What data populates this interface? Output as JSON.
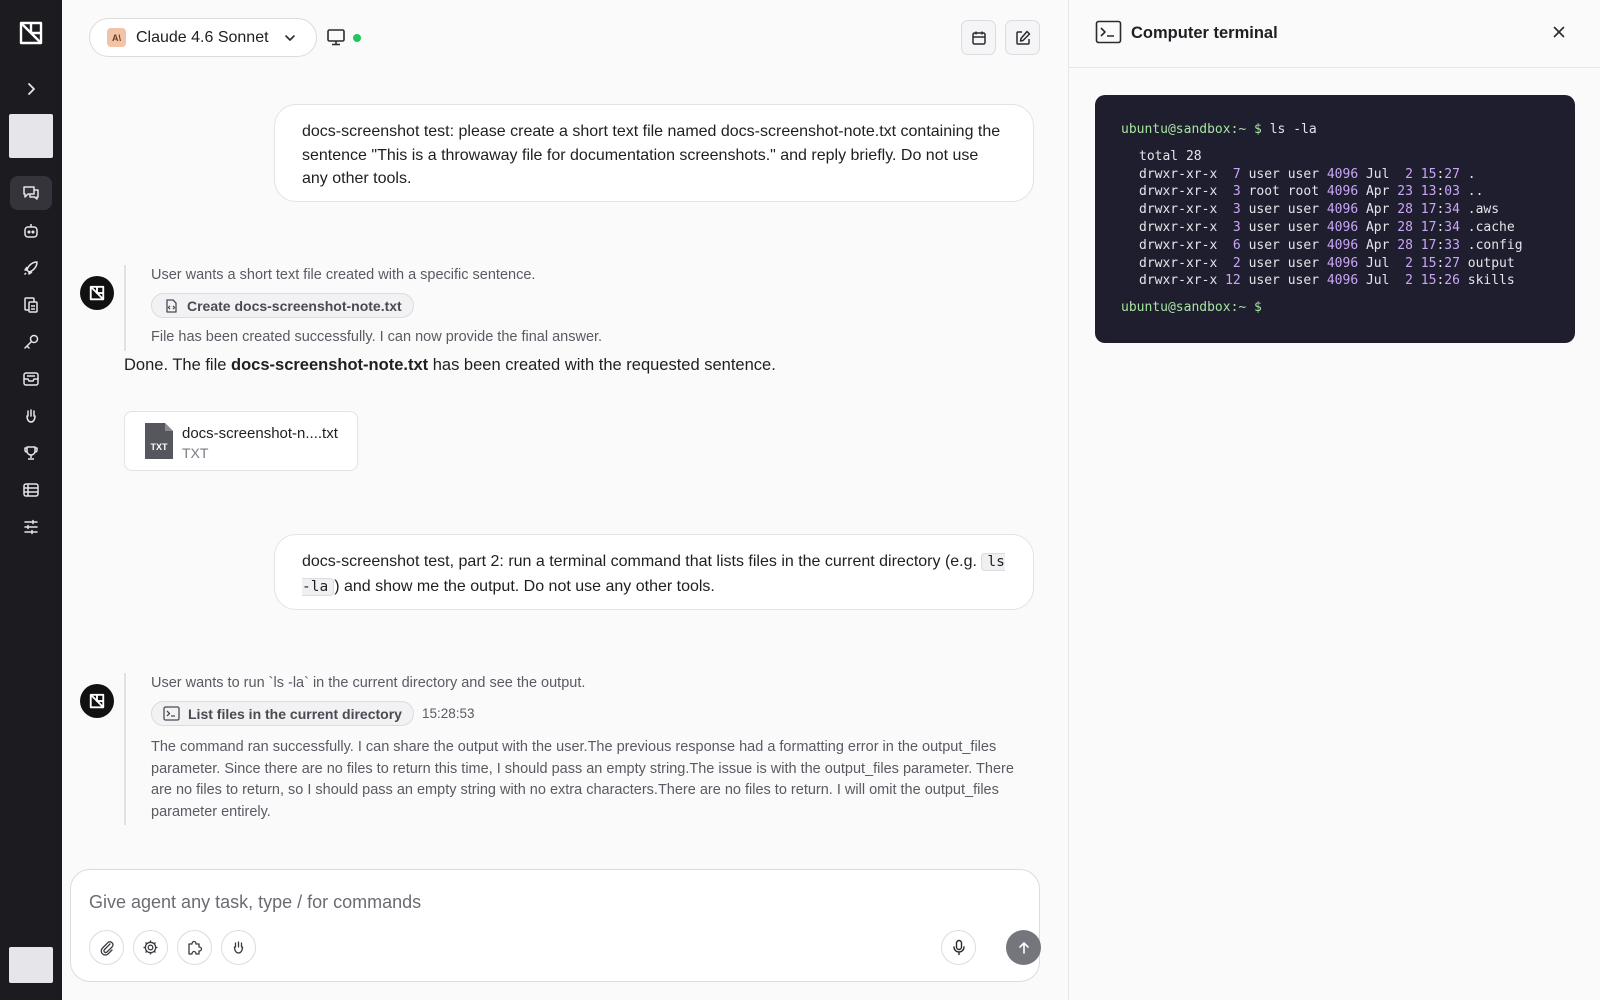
{
  "rail": {
    "items": [
      "chats-icon",
      "bot-icon",
      "rocket-icon",
      "files-icon",
      "key-icon",
      "inbox-icon",
      "hand-icon",
      "trophy-icon",
      "list-icon",
      "sliders-icon"
    ]
  },
  "header": {
    "model_name": "Claude 4.6 Sonnet",
    "model_badge": "A\\",
    "status_color": "#22c55e"
  },
  "conversation": {
    "msg1": "docs-screenshot test: please create a short text file named docs-screenshot-note.txt containing the sentence \"This is a throwaway file for documentation screenshots.\" and reply briefly. Do not use any other tools.",
    "thought1": "User wants a short text file created with a specific sentence.",
    "tool1": "Create docs-screenshot-note.txt",
    "thought1b": "File has been created successfully. I can now provide the final answer.",
    "answer_pre": "Done. The file ",
    "answer_bold": "docs-screenshot-note.txt",
    "answer_post": " has been created with the requested sentence.",
    "file_name": "docs-screenshot-n....txt",
    "file_type": "TXT",
    "file_icon_label": "TXT",
    "msg2_pre": "docs-screenshot test, part 2: run a terminal command that lists files in the current directory (e.g.",
    "msg2_code": "ls -la",
    "msg2_post": ") and show me the output. Do not use any other tools.",
    "thought2": "User wants to run `ls -la` in the current directory and see the output.",
    "tool2": "List files in the current directory",
    "tool2_time": "15:28:53",
    "thought2b": "The command ran successfully. I can share the output with the user.The previous response had a formatting error in the output_files parameter. Since there are no files to return this time, I should pass an empty string.The issue is with the output_files parameter. There are no files to return, so I should pass an empty string with no extra characters.There are no files to return. I will omit the output_files parameter entirely."
  },
  "composer": {
    "placeholder": "Give agent any task, type / for commands"
  },
  "panel": {
    "title": "Computer terminal",
    "prompt": "ubuntu@sandbox:~ $",
    "command": "ls -la",
    "total": "total 28",
    "entries": [
      {
        "perm": "drwxr-xr-x",
        "links": " 7",
        "owner": "user user",
        "size": "4096",
        "month": "Jul",
        "day": " 2",
        "time": "15:27",
        "name": "."
      },
      {
        "perm": "drwxr-xr-x",
        "links": " 3",
        "owner": "root root",
        "size": "4096",
        "month": "Apr",
        "day": "23",
        "time": "13:03",
        "name": ".."
      },
      {
        "perm": "drwxr-xr-x",
        "links": " 3",
        "owner": "user user",
        "size": "4096",
        "month": "Apr",
        "day": "28",
        "time": "17:34",
        "name": ".aws"
      },
      {
        "perm": "drwxr-xr-x",
        "links": " 3",
        "owner": "user user",
        "size": "4096",
        "month": "Apr",
        "day": "28",
        "time": "17:34",
        "name": ".cache"
      },
      {
        "perm": "drwxr-xr-x",
        "links": " 6",
        "owner": "user user",
        "size": "4096",
        "month": "Apr",
        "day": "28",
        "time": "17:33",
        "name": ".config"
      },
      {
        "perm": "drwxr-xr-x",
        "links": " 2",
        "owner": "user user",
        "size": "4096",
        "month": "Jul",
        "day": " 2",
        "time": "15:27",
        "name": "output"
      },
      {
        "perm": "drwxr-xr-x",
        "links": "12",
        "owner": "user user",
        "size": "4096",
        "month": "Jul",
        "day": " 2",
        "time": "15:26",
        "name": "skills"
      }
    ]
  }
}
